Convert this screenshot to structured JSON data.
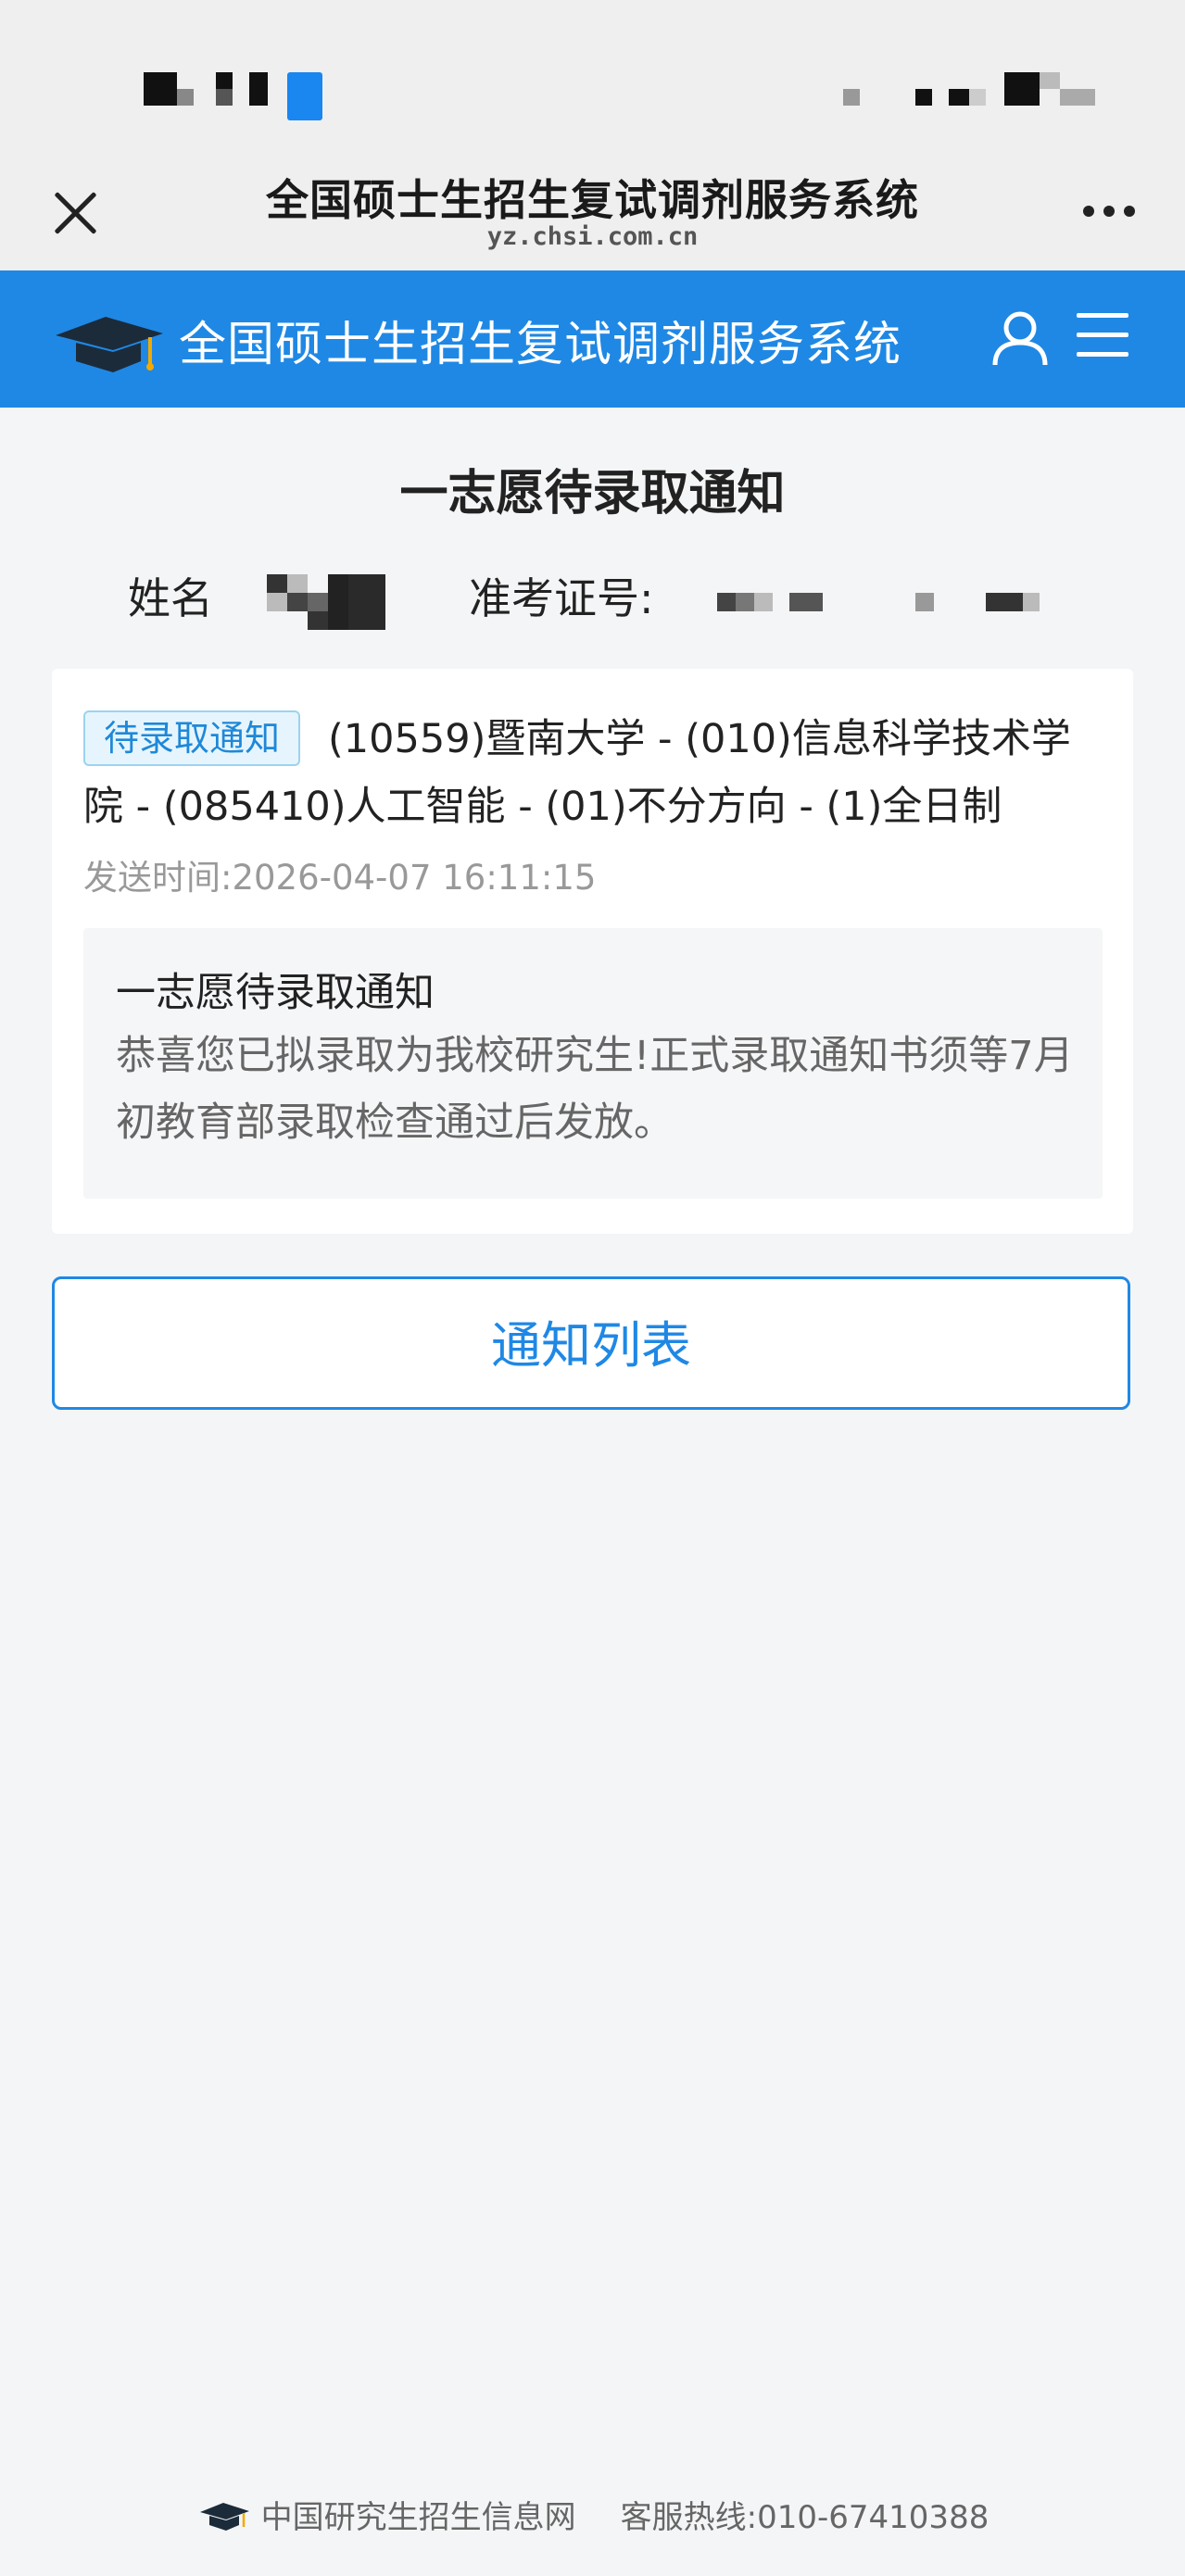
{
  "titlebar": {
    "title": "全国硕士生招生复试调剂服务系统",
    "url": "yz.chsi.com.cn"
  },
  "header": {
    "app_title": "全国硕士生招生复试调剂服务系统"
  },
  "page": {
    "title": "一志愿待录取通知",
    "name_label": "姓名",
    "ticket_label": "准考证号:"
  },
  "notice": {
    "tag": "待录取通知",
    "program": "(10559)暨南大学 - (010)信息科学技术学院 - (085410)人工智能 - (01)不分方向 - (1)全日制",
    "send_time": "发送时间:2026-04-07 16:11:15",
    "message_title": "一志愿待录取通知",
    "message_body": "恭喜您已拟录取为我校研究生!正式录取通知书须等7月初教育部录取检查通过后发放。"
  },
  "button": {
    "label": "通知列表"
  },
  "footer": {
    "site": "中国研究生招生信息网",
    "hotline": "客服热线:010-67410388"
  },
  "colors": {
    "brand_blue": "#1f88e5",
    "tag_text": "#1f88d8",
    "page_background": "#f4f5f7"
  },
  "icons": {
    "close": "close-icon",
    "more": "more-dots-icon",
    "logo": "graduation-cap-icon",
    "user": "user-icon",
    "menu": "hamburger-menu-icon"
  }
}
